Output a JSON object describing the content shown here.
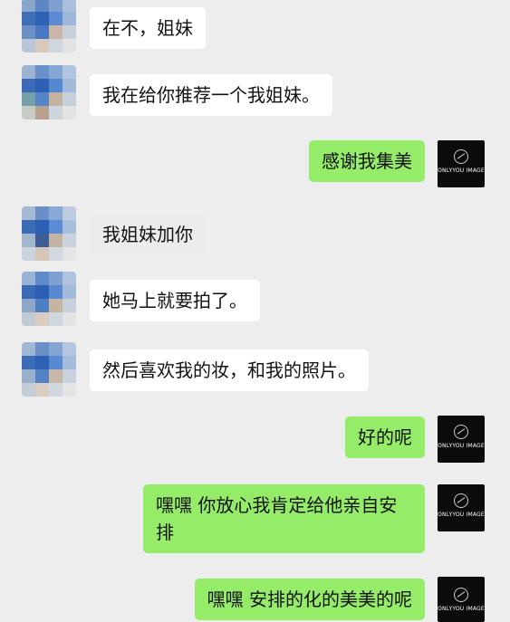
{
  "messages": [
    {
      "side": "left",
      "text": "在不，姐妹"
    },
    {
      "side": "left",
      "text": "我在给你推荐一个我姐妹。"
    },
    {
      "side": "right",
      "text": "感谢我集美"
    },
    {
      "side": "left",
      "text": "我姐妹加你"
    },
    {
      "side": "left",
      "text": "她马上就要拍了。"
    },
    {
      "side": "left",
      "text": "然后喜欢我的妆，和我的照片。"
    },
    {
      "side": "right",
      "text": "好的呢"
    },
    {
      "side": "right",
      "text": "嘿嘿 你放心我肯定给他亲自安排"
    },
    {
      "side": "right",
      "text": "嘿嘿 安排的化的美美的呢"
    }
  ],
  "self_avatar": {
    "brand": "ONLYYOU IMAGE"
  },
  "colors": {
    "background": "#ededed",
    "incoming_bubble": "#ffffff",
    "outgoing_bubble": "#95ec69"
  },
  "icons": {
    "contact_avatar": "pixelated-avatar",
    "self_avatar": "brand-logo-avatar"
  }
}
